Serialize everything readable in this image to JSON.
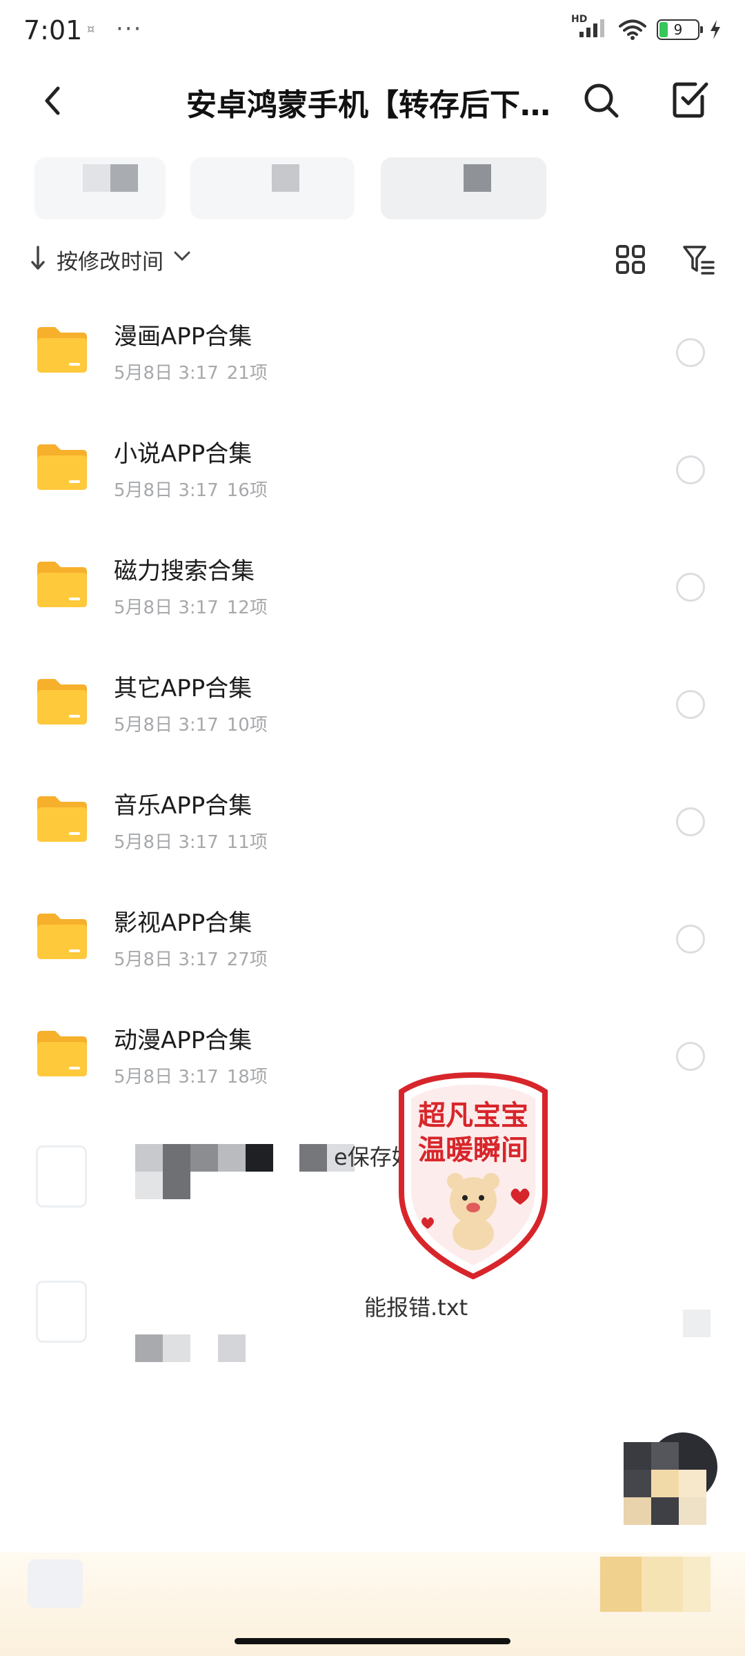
{
  "status_bar": {
    "time": "7:01",
    "more": "···",
    "network": "HD",
    "battery": "9"
  },
  "header": {
    "title": "安卓鸿蒙手机【转存后下…",
    "back_icon": "chevron-left-icon",
    "search_icon": "search-icon",
    "select_icon": "checkbox-icon"
  },
  "sort": {
    "label": "按修改时间",
    "grid_icon": "grid-view-icon",
    "filter_icon": "filter-icon"
  },
  "files": [
    {
      "name": "漫画APP合集",
      "date": "5月8日 3:17",
      "count": "21项"
    },
    {
      "name": "小说APP合集",
      "date": "5月8日 3:17",
      "count": "16项"
    },
    {
      "name": "磁力搜索合集",
      "date": "5月8日 3:17",
      "count": "12项"
    },
    {
      "name": "其它APP合集",
      "date": "5月8日 3:17",
      "count": "10项"
    },
    {
      "name": "音乐APP合集",
      "date": "5月8日 3:17",
      "count": "11项"
    },
    {
      "name": "影视APP合集",
      "date": "5月8日 3:17",
      "count": "27项"
    },
    {
      "name": "动漫APP合集",
      "date": "5月8日 3:17",
      "count": "18项"
    }
  ],
  "obscured_files": [
    {
      "visible_text": "e保存好 方便求"
    },
    {
      "visible_text": "能报错.txt"
    }
  ],
  "sticker": {
    "line1": "超凡宝宝",
    "line2": "温暖瞬间"
  },
  "colors": {
    "folder": "#FFC93C",
    "folder_dark": "#F6B02C",
    "radio_border": "#DCDDE0",
    "meta_text": "#A6A8AB",
    "sticker_red": "#D7262B"
  }
}
